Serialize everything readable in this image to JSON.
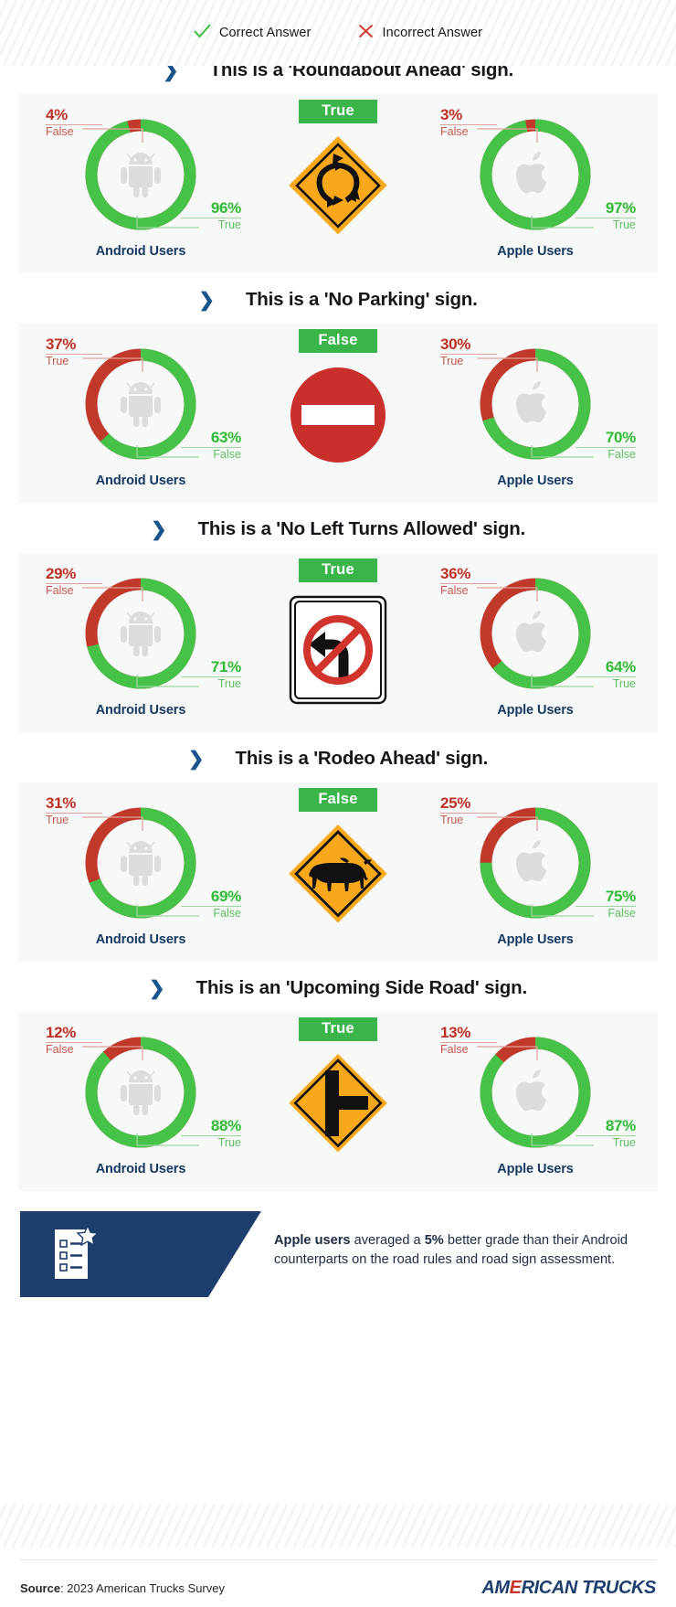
{
  "legend": {
    "correct": {
      "label": "Correct Answer",
      "icon": "check-icon",
      "color": "#2fbb33"
    },
    "incorrect": {
      "label": "Incorrect Answer",
      "icon": "cross-icon",
      "color": "#cf3a2c"
    }
  },
  "labels": {
    "android_users": "Android Users",
    "apple_users": "Apple Users",
    "chevron": "❯"
  },
  "colors": {
    "green": "#3ab54a",
    "donut_green": "#45c247",
    "red": "#c0392b",
    "navy": "#1d3f6e",
    "panel_bg": "#f7f8f8",
    "sign_yellow": "#f9a81b",
    "sign_red": "#c9302c"
  },
  "chart_data": [
    {
      "type": "pie",
      "title": "This is a 'Roundabout Ahead' sign.",
      "correct_answer": "True",
      "sign": "roundabout-ahead",
      "series": [
        {
          "name": "Android Users",
          "correct_label": "True",
          "correct_value": 96,
          "correct_display": "96%",
          "incorrect_label": "False",
          "incorrect_value": 4,
          "incorrect_display": "4%"
        },
        {
          "name": "Apple Users",
          "correct_label": "True",
          "correct_value": 97,
          "correct_display": "97%",
          "incorrect_label": "False",
          "incorrect_value": 3,
          "incorrect_display": "3%"
        }
      ]
    },
    {
      "type": "pie",
      "title": "This is a 'No Parking' sign.",
      "correct_answer": "False",
      "sign": "no-entry",
      "series": [
        {
          "name": "Android Users",
          "correct_label": "False",
          "correct_value": 63,
          "correct_display": "63%",
          "incorrect_label": "True",
          "incorrect_value": 37,
          "incorrect_display": "37%"
        },
        {
          "name": "Apple Users",
          "correct_label": "False",
          "correct_value": 70,
          "correct_display": "70%",
          "incorrect_label": "True",
          "incorrect_value": 30,
          "incorrect_display": "30%"
        }
      ]
    },
    {
      "type": "pie",
      "title": "This is a 'No Left Turns Allowed' sign.",
      "correct_answer": "True",
      "sign": "no-left-turn",
      "series": [
        {
          "name": "Android Users",
          "correct_label": "True",
          "correct_value": 71,
          "correct_display": "71%",
          "incorrect_label": "False",
          "incorrect_value": 29,
          "incorrect_display": "29%"
        },
        {
          "name": "Apple Users",
          "correct_label": "True",
          "correct_value": 64,
          "correct_display": "64%",
          "incorrect_label": "False",
          "incorrect_value": 36,
          "incorrect_display": "36%"
        }
      ]
    },
    {
      "type": "pie",
      "title": "This is a 'Rodeo Ahead' sign.",
      "correct_answer": "False",
      "sign": "cattle-crossing",
      "series": [
        {
          "name": "Android Users",
          "correct_label": "False",
          "correct_value": 69,
          "correct_display": "69%",
          "incorrect_label": "True",
          "incorrect_value": 31,
          "incorrect_display": "31%"
        },
        {
          "name": "Apple Users",
          "correct_label": "False",
          "correct_value": 75,
          "correct_display": "75%",
          "incorrect_label": "True",
          "incorrect_value": 25,
          "incorrect_display": "25%"
        }
      ]
    },
    {
      "type": "pie",
      "title": "This is an 'Upcoming Side Road' sign.",
      "correct_answer": "True",
      "sign": "side-road",
      "series": [
        {
          "name": "Android Users",
          "correct_label": "True",
          "correct_value": 88,
          "correct_display": "88%",
          "incorrect_label": "False",
          "incorrect_value": 12,
          "incorrect_display": "12%"
        },
        {
          "name": "Apple Users",
          "correct_label": "True",
          "correct_value": 87,
          "correct_display": "87%",
          "incorrect_label": "False",
          "incorrect_value": 13,
          "incorrect_display": "13%"
        }
      ]
    }
  ],
  "callout": {
    "icon": "checklist-star-icon",
    "text_parts": {
      "bold1": "Apple users",
      "mid1": " averaged a ",
      "bold2": "5%",
      "mid2": " better grade than their Android counterparts on the road rules and road sign assessment."
    }
  },
  "footer": {
    "source_label": "Source",
    "source_value": ": 2023 American Trucks Survey",
    "brand_pre": "AM",
    "brand_e": "E",
    "brand_post": "RICAN TRUCKS"
  }
}
